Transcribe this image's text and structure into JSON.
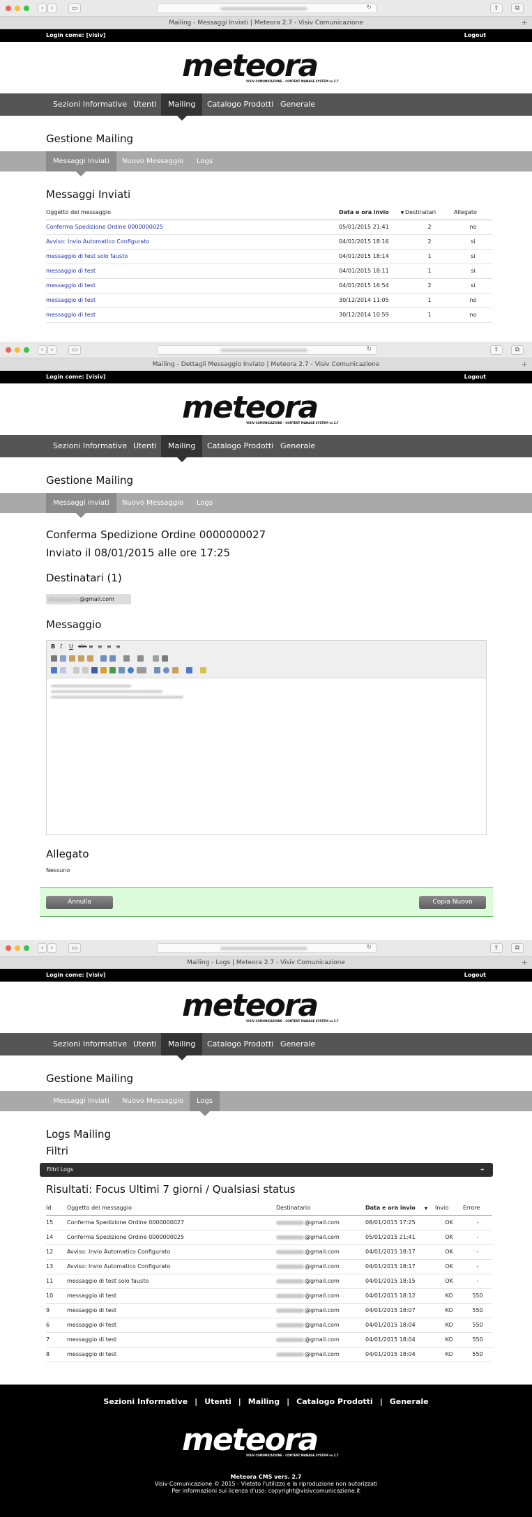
{
  "windows": [
    {
      "tab_title": "Mailing - Messaggi Inviati | Meteora 2.7 - Visiv Comunicazione",
      "login_label": "Login come: [visiv]",
      "logout_label": "Logout",
      "logo_text": "meteora",
      "logo_tagline": "VISIV COMUNICAZIONE - CONTENT MANAGE SYSTEM vs 2.7",
      "main_nav": [
        "Sezioni Informative",
        "Utenti",
        "Mailing",
        "Catalogo Prodotti",
        "Generale"
      ],
      "section_title": "Gestione Mailing",
      "sub_nav": [
        "Messaggi Inviati",
        "Nuovo Messaggio",
        "Logs"
      ],
      "page_title": "Messaggi Inviati",
      "table": {
        "headers": [
          "Oggetto del messaggio",
          "Data e ora invio",
          "Destinatari",
          "Allegato"
        ],
        "sort_indicator": "▼",
        "rows": [
          {
            "subject": "Conferma Spedizione Ordine 0000000025",
            "date": "05/01/2015 21:41",
            "recipients": "2",
            "attachment": "no"
          },
          {
            "subject": "Avviso: Invio Automatico Configurato",
            "date": "04/01/2015 18:16",
            "recipients": "2",
            "attachment": "si"
          },
          {
            "subject": "messaggio di test solo fausto",
            "date": "04/01/2015 18:14",
            "recipients": "1",
            "attachment": "si"
          },
          {
            "subject": "messaggio di test",
            "date": "04/01/2015 18:11",
            "recipients": "1",
            "attachment": "si"
          },
          {
            "subject": "messaggio di test",
            "date": "04/01/2015 16:54",
            "recipients": "2",
            "attachment": "si"
          },
          {
            "subject": "messaggio di test",
            "date": "30/12/2014 11:05",
            "recipients": "1",
            "attachment": "no"
          },
          {
            "subject": "messaggio di test",
            "date": "30/12/2014 10:59",
            "recipients": "1",
            "attachment": "no"
          }
        ]
      }
    },
    {
      "tab_title": "Mailing - Dettagli Messaggio Inviato | Meteora 2.7 - Visiv Comunicazione",
      "login_label": "Login come: [visiv]",
      "logout_label": "Logout",
      "logo_text": "meteora",
      "logo_tagline": "VISIV COMUNICAZIONE - CONTENT MANAGE SYSTEM vs 2.7",
      "main_nav": [
        "Sezioni Informative",
        "Utenti",
        "Mailing",
        "Catalogo Prodotti",
        "Generale"
      ],
      "section_title": "Gestione Mailing",
      "sub_nav": [
        "Messaggi Inviati",
        "Nuovo Messaggio",
        "Logs"
      ],
      "message_title": "Conferma Spedizione Ordine 0000000027",
      "sent_info": "Inviato il 08/01/2015 alle ore 17:25",
      "recipients_heading": "Destinatari (1)",
      "recipient_email_suffix": "@gmail.com",
      "message_heading": "Messaggio",
      "attachment_heading": "Allegato",
      "attachment_value": "Nessuno",
      "cancel_button": "Annulla",
      "copy_button": "Copia Nuovo"
    },
    {
      "tab_title": "Mailing - Logs | Meteora 2.7 - Visiv Comunicazione",
      "login_label": "Login come: [visiv]",
      "logout_label": "Logout",
      "logo_text": "meteora",
      "logo_tagline": "VISIV COMUNICAZIONE - CONTENT MANAGE SYSTEM vs 2.7",
      "main_nav": [
        "Sezioni Informative",
        "Utenti",
        "Mailing",
        "Catalogo Prodotti",
        "Generale"
      ],
      "section_title": "Gestione Mailing",
      "sub_nav": [
        "Messaggi Inviati",
        "Nuovo Messaggio",
        "Logs"
      ],
      "page_title": "Logs Mailing",
      "filters_heading": "Filtri",
      "filter_bar_label": "Filtri Logs",
      "filter_bar_plus": "+",
      "results_heading": "Risultati: Focus Ultimi 7 giorni / Qualsiasi status",
      "table": {
        "headers": [
          "Id",
          "Oggetto del messaggio",
          "Destinatario",
          "Data e ora invio",
          "Invio",
          "Errore"
        ],
        "sort_indicator": "▼",
        "rows": [
          {
            "id": "15",
            "subject": "Conferma Spedizione Ordine 0000000027",
            "email": "@gmail.com",
            "date": "08/01/2015 17:25",
            "status": "OK",
            "error": "-"
          },
          {
            "id": "14",
            "subject": "Conferma Spedizione Ordine 0000000025",
            "email": "@gmail.com",
            "date": "05/01/2015 21:41",
            "status": "OK",
            "error": "-"
          },
          {
            "id": "12",
            "subject": "Avviso: Invio Automatico Configurato",
            "email": "@gmail.com",
            "date": "04/01/2015 18:17",
            "status": "OK",
            "error": "-"
          },
          {
            "id": "13",
            "subject": "Avviso: Invio Automatico Configurato",
            "email": "@gmail.com",
            "date": "04/01/2015 18:17",
            "status": "OK",
            "error": "-"
          },
          {
            "id": "11",
            "subject": "messaggio di test solo fausto",
            "email": "@gmail.com",
            "date": "04/01/2015 18:15",
            "status": "OK",
            "error": "-"
          },
          {
            "id": "10",
            "subject": "messaggio di test",
            "email": "@gmail.com",
            "date": "04/01/2015 18:12",
            "status": "KO",
            "error": "550"
          },
          {
            "id": "9",
            "subject": "messaggio di test",
            "email": "@gmail.com",
            "date": "04/01/2015 18:07",
            "status": "KO",
            "error": "550"
          },
          {
            "id": "6",
            "subject": "messaggio di test",
            "email": "@gmail.com",
            "date": "04/01/2015 18:04",
            "status": "KO",
            "error": "550"
          },
          {
            "id": "7",
            "subject": "messaggio di test",
            "email": "@gmail.com",
            "date": "04/01/2015 18:04",
            "status": "KO",
            "error": "550"
          },
          {
            "id": "8",
            "subject": "messaggio di test",
            "email": "@gmail.com",
            "date": "04/01/2015 18:04",
            "status": "KO",
            "error": "550"
          }
        ]
      },
      "footer": {
        "nav": [
          "Sezioni Informative",
          "Utenti",
          "Mailing",
          "Catalogo Prodotti",
          "Generale"
        ],
        "separator": "|",
        "version": "Meteora CMS vers. 2.7",
        "copyright": "Visiv Comunicazione © 2015 - Vietato l'utilizzo e la riproduzione non autorizzati",
        "license": "Per informazioni sui licenza d'uso: copyright@visivcomunicazione.it"
      }
    }
  ],
  "colors": {
    "main_nav_bg": "#555555",
    "main_nav_active": "#333333",
    "sub_nav_bg": "#a9a9a9",
    "heading_red": "#8b1a1a",
    "link_blue": "#2233aa",
    "ok_green": "#2d7d1e",
    "ko_red": "#c0271f",
    "button_bar_bg": "#dbfbdb"
  }
}
